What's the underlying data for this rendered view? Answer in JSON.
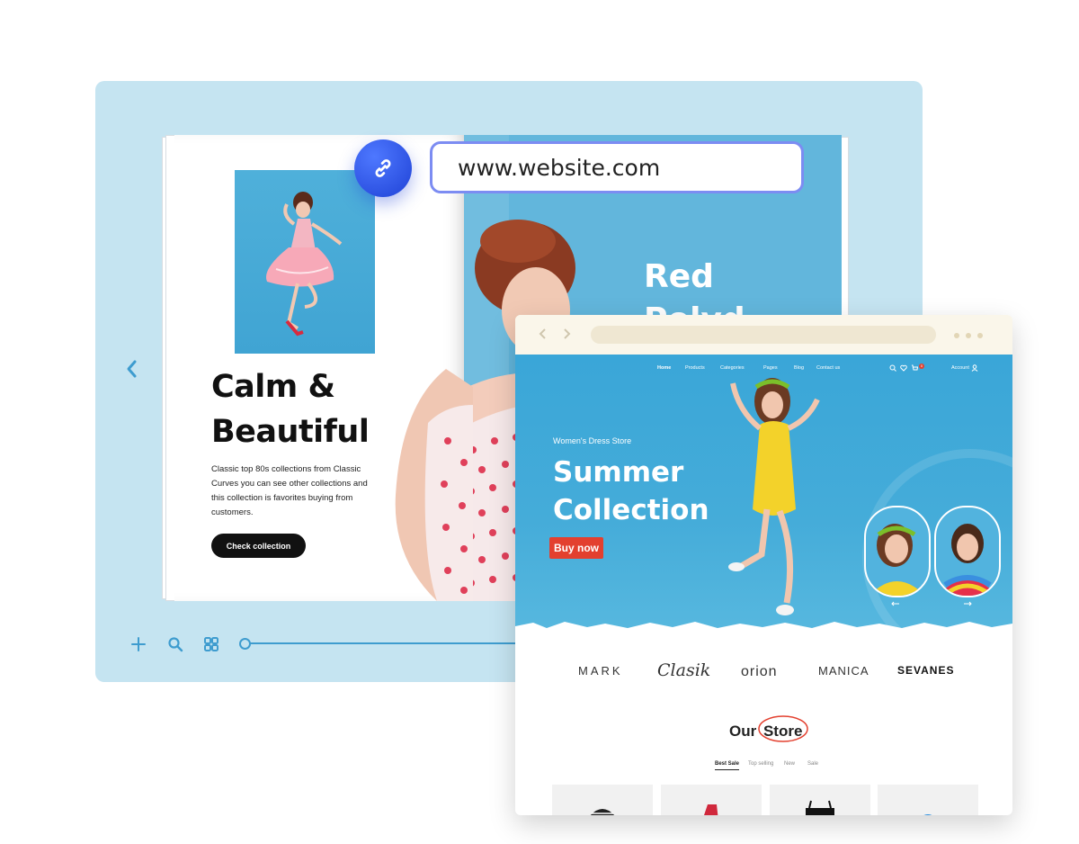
{
  "url_bar": {
    "url": "www.website.com"
  },
  "flipbook": {
    "headline_line1": "Calm &",
    "headline_line2": "Beautiful",
    "body_text": "Classic top 80s collections from Classic Curves you can see other collections and this collection is favorites buying from customers.",
    "cta_label": "Check collection",
    "right_page_title_line1": "Red",
    "right_page_title_line2": "Polyd..."
  },
  "toolbar": {
    "icons": [
      "plus-icon",
      "search-icon",
      "grid-icon"
    ]
  },
  "website": {
    "nav": {
      "home": "Home",
      "products": "Products",
      "categories": "Categories",
      "pages": "Pages",
      "blog": "Blog",
      "contact": "Contact us",
      "account": "Account",
      "cart_count": "0"
    },
    "hero": {
      "tagline": "Women's Dress Store",
      "title_line1": "Summer",
      "title_line2": "Collection",
      "cta_label": "Buy now"
    },
    "brands": [
      "MARK",
      "Clasik",
      "orion",
      "MANICA",
      "SEVANES"
    ],
    "store_title_1": "Our",
    "store_title_2": "Store",
    "tabs": [
      "Best Sale",
      "Top selling",
      "New",
      "Sale"
    ],
    "active_tab": "Best Sale"
  },
  "colors": {
    "panel_bg": "#c5e4f1",
    "accent_blue": "#2448e0",
    "url_border": "#7c8cf2",
    "hero_blue": "#3aa6d8",
    "buy_red": "#e3402f"
  }
}
